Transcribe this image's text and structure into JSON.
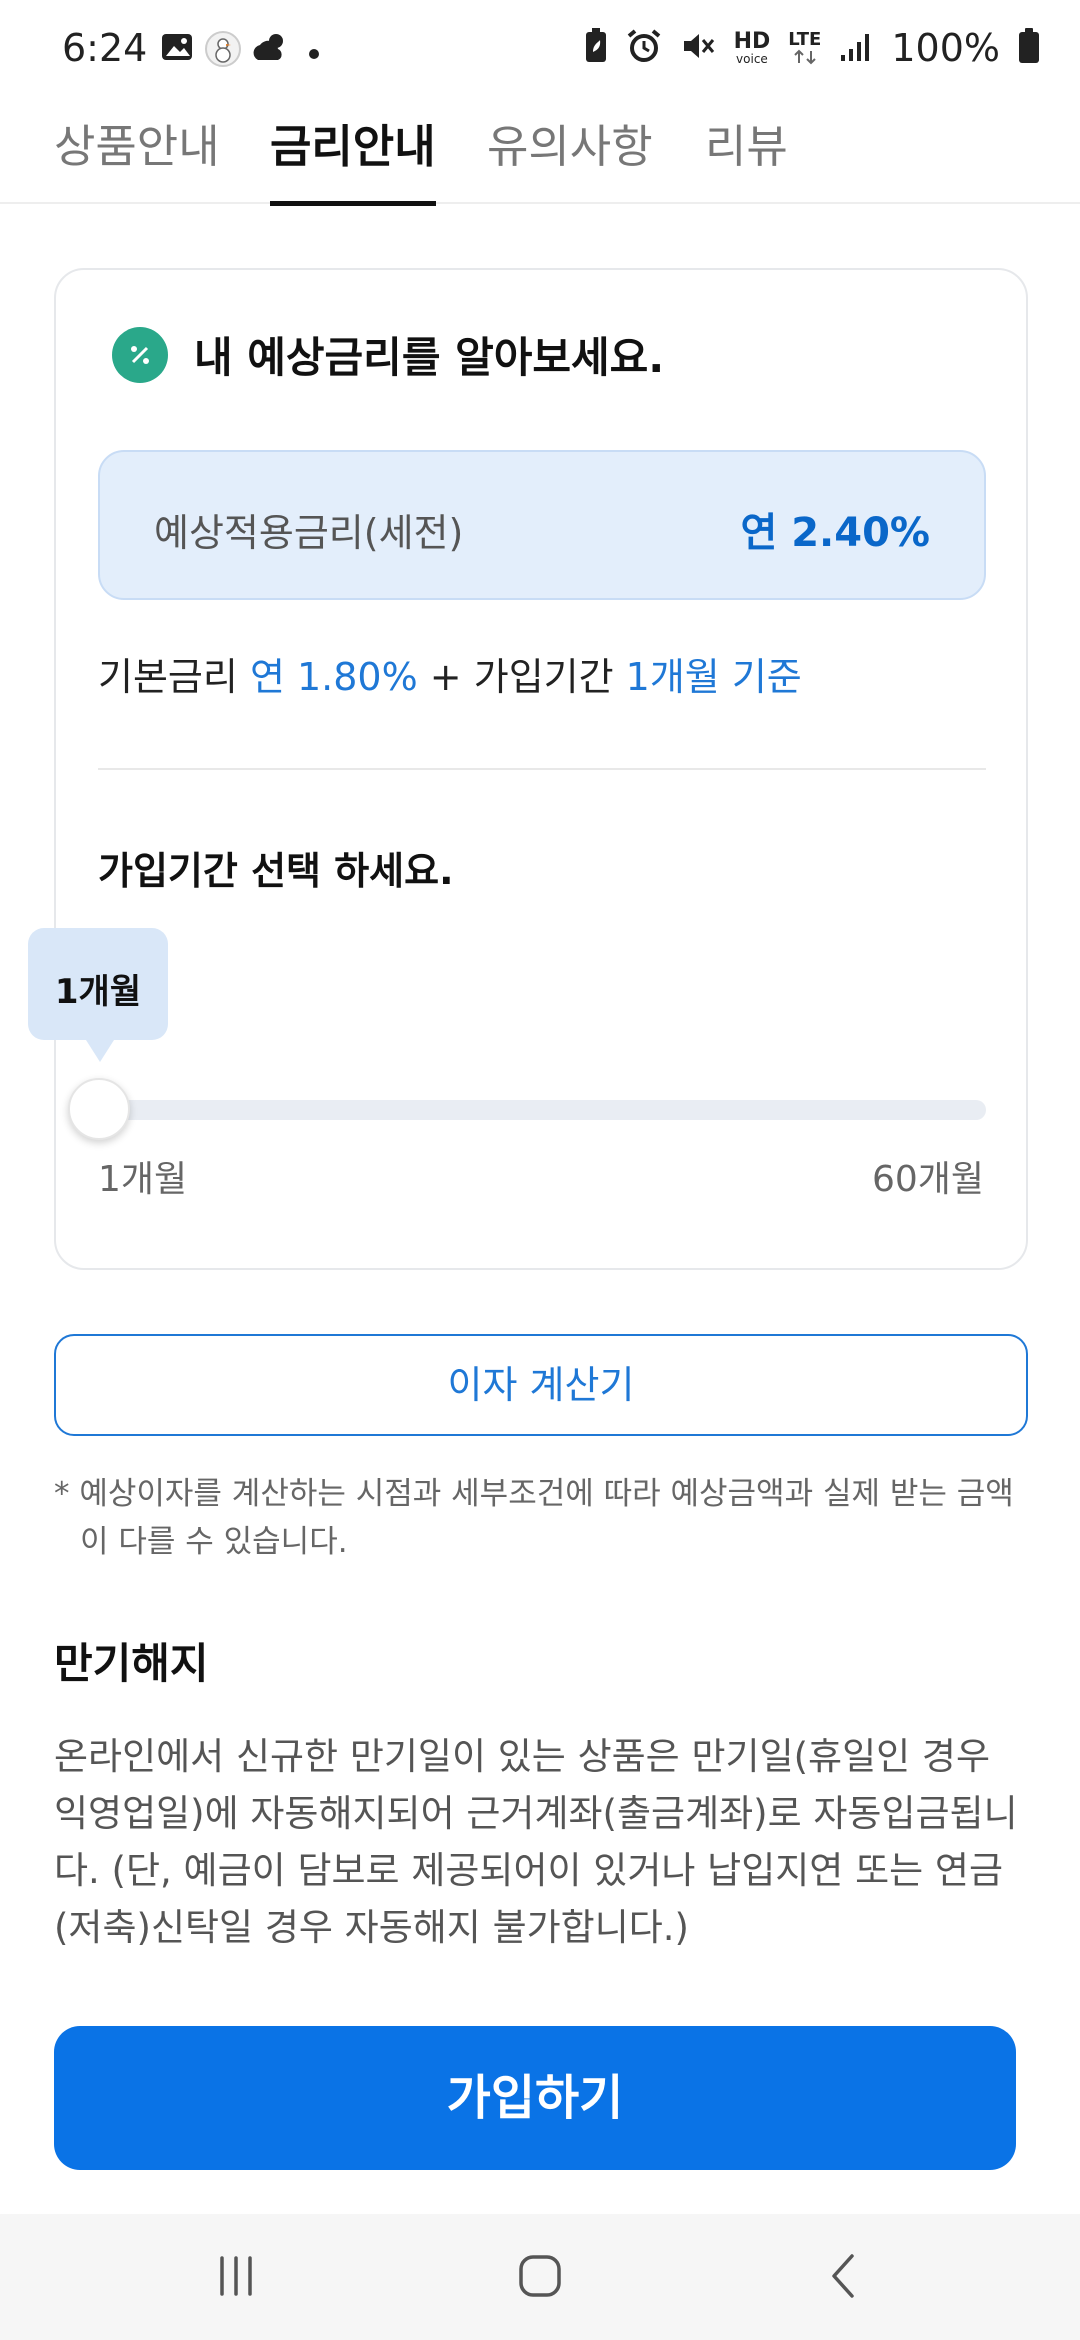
{
  "status_bar": {
    "time": "6:24",
    "network": "LTE",
    "voice": "HD voice",
    "battery": "100%",
    "icons": [
      "gallery-icon",
      "snowman-icon",
      "weather-icon",
      "notification-dot-icon",
      "battery-saver-icon",
      "alarm-icon",
      "mute-icon",
      "hd-voice-icon",
      "lte-icon",
      "signal-icon",
      "battery-icon"
    ]
  },
  "tabs": [
    {
      "label": "상품안내",
      "active": false
    },
    {
      "label": "금리안내",
      "active": true
    },
    {
      "label": "유의사항",
      "active": false
    },
    {
      "label": "리뷰",
      "active": false
    }
  ],
  "rate_card": {
    "icon": "percent-icon",
    "title": "내 예상금리를 알아보세요.",
    "rate_label": "예상적용금리(세전)",
    "rate_value": "연 2.40%",
    "formula": {
      "base_label": "기본금리",
      "base_value": "연 1.80%",
      "plus": "+",
      "period_label": "가입기간",
      "period_value": "1개월 기준"
    },
    "select_title": "가입기간 선택 하세요.",
    "slider": {
      "current_label": "1개월",
      "current": 1,
      "min_label": "1개월",
      "max_label": "60개월",
      "min": 1,
      "max": 60
    }
  },
  "calculator_button": "이자 계산기",
  "note": "* 예상이자를 계산하는 시점과 세부조건에 따라 예상금액과 실제 받는 금액이 다를 수 있습니다.",
  "maturity": {
    "title": "만기해지",
    "body": "온라인에서 신규한 만기일이 있는 상품은 만기일(휴일인 경우 익영업일)에 자동해지되어 근거계좌(출금계좌)로 자동입금됩니다. (단, 예금이 담보로 제공되어이 있거나 납입지연 또는 연금(저축)신탁일 경우 자동해지 불가합니다.)"
  },
  "join_button": "가입하기",
  "nav": [
    "recent-apps-icon",
    "home-icon",
    "back-icon"
  ],
  "colors": {
    "primary": "#0a73e6",
    "accent_blue": "#1f78d6",
    "rate_box_bg": "#e3eefb",
    "icon_green": "#2aa88a"
  }
}
